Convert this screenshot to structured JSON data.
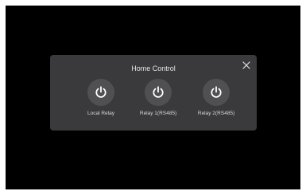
{
  "dialog": {
    "title": "Home Control",
    "close_icon": "close-icon"
  },
  "relays": [
    {
      "label": "Local Relay",
      "icon": "power-icon"
    },
    {
      "label": "Relay 1(RS485)",
      "icon": "power-icon"
    },
    {
      "label": "Relay 2(RS485)",
      "icon": "power-icon"
    }
  ],
  "colors": {
    "screen_background": "#000000",
    "dialog_background": "#3a3a3c",
    "button_background": "#505052",
    "icon": "#ffffff",
    "text": "#e6e6e6"
  }
}
